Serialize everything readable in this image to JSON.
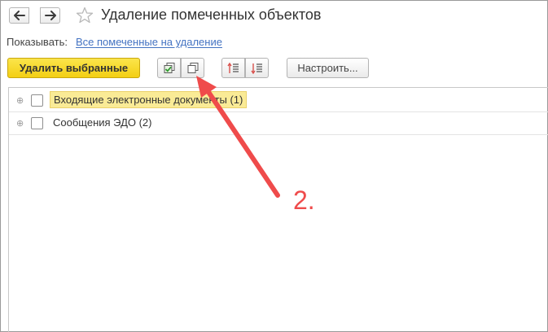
{
  "header": {
    "title": "Удаление помеченных объектов"
  },
  "filter": {
    "label": "Показывать:",
    "link": "Все помеченные на удаление"
  },
  "toolbar": {
    "delete_label": "Удалить выбранные",
    "settings_label": "Настроить..."
  },
  "tree": {
    "rows": [
      {
        "label": "Входящие электронные документы (1)",
        "selected": true,
        "checked": false
      },
      {
        "label": "Сообщения ЭДО (2)",
        "selected": false,
        "checked": false
      }
    ]
  },
  "annotation": {
    "label": "2.",
    "color": "#ef4b4b"
  },
  "colors": {
    "primary_button": "#f5d321",
    "link": "#4473c2",
    "selection": "#faeb96"
  },
  "icons": {
    "back": "arrow-left-icon",
    "forward": "arrow-right-icon",
    "favorite": "star-icon",
    "check_all": "check-all-icon",
    "uncheck_all": "uncheck-all-icon",
    "expand": "expand-list-icon",
    "collapse": "collapse-list-icon",
    "expander": "plus-expander-icon"
  }
}
